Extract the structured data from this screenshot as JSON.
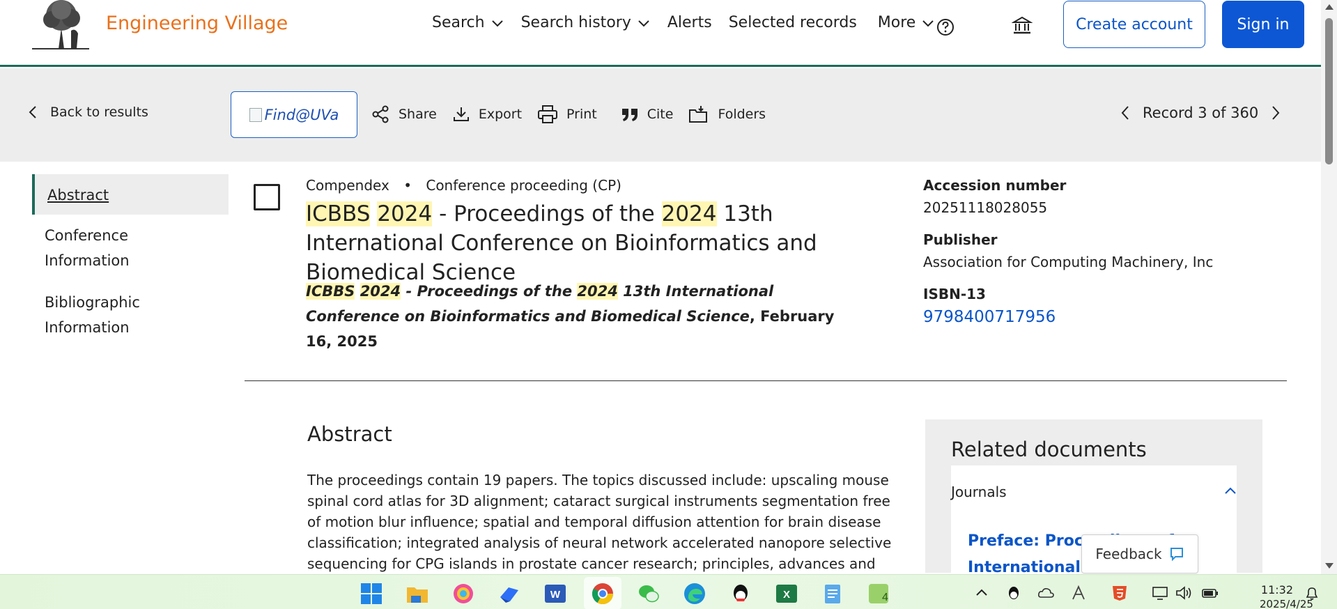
{
  "header": {
    "brand": "Engineering Village",
    "nav": [
      {
        "label": "Search",
        "dropdown": true
      },
      {
        "label": "Search history",
        "dropdown": true
      },
      {
        "label": "Alerts",
        "dropdown": false
      },
      {
        "label": "Selected records",
        "dropdown": false
      },
      {
        "label": "More",
        "dropdown": true
      }
    ],
    "create_account": "Create account",
    "sign_in": "Sign in"
  },
  "toolbar": {
    "back": "Back to results",
    "find": "Find@UVa",
    "share": "Share",
    "export": "Export",
    "print": "Print",
    "cite": "Cite",
    "folders": "Folders",
    "record": "Record 3 of 360"
  },
  "leftnav": {
    "items": [
      "Abstract",
      "Conference Information",
      "Bibliographic Information"
    ]
  },
  "record": {
    "database": "Compendex",
    "doc_type": "Conference proceeding (CP)",
    "title_parts": {
      "p1": "ICBBS",
      "p2": "2024",
      "p3": " - Proceedings of the ",
      "p4": "2024",
      "p5": " 13th International Conference on Bioinformatics and Biomedical Science"
    },
    "source_parts": {
      "s1": "ICBBS",
      "s2": "2024",
      "s3": " - Proceedings of the ",
      "s4": "2024",
      "s5": " 13th International Conference on Bioinformatics and Biomedical Science",
      "s6": ", February 16, 2025"
    }
  },
  "details": {
    "accession_label": "Accession number",
    "accession_value": "20251118028055",
    "publisher_label": "Publisher",
    "publisher_value": "Association for Computing Machinery, Inc",
    "isbn_label": "ISBN-13",
    "isbn_value": "9798400717956"
  },
  "abstract": {
    "heading": "Abstract",
    "text": "The proceedings contain 19 papers. The topics discussed include: upscaling mouse spinal cord atlas for 3D alignment; cataract surgical instruments segmentation free of motion blur influence; spatial and temporal diffusion attention for brain disease classification; integrated analysis of neural network accelerated nanopore selective sequencing for CPG islands in prostate cancer research; principles, advances and"
  },
  "related": {
    "heading": "Related documents",
    "section": "Journals",
    "link": "Preface: Proceedings of International C"
  },
  "feedback": "Feedback",
  "taskbar": {
    "time": "11:32",
    "date": "2025/4/25"
  },
  "colors": {
    "brand": "#e9711c",
    "primary": "#0d57d4",
    "accent_line": "#1b6b5a",
    "highlight": "#fff6b3",
    "toolbar_bg": "#ededed"
  }
}
